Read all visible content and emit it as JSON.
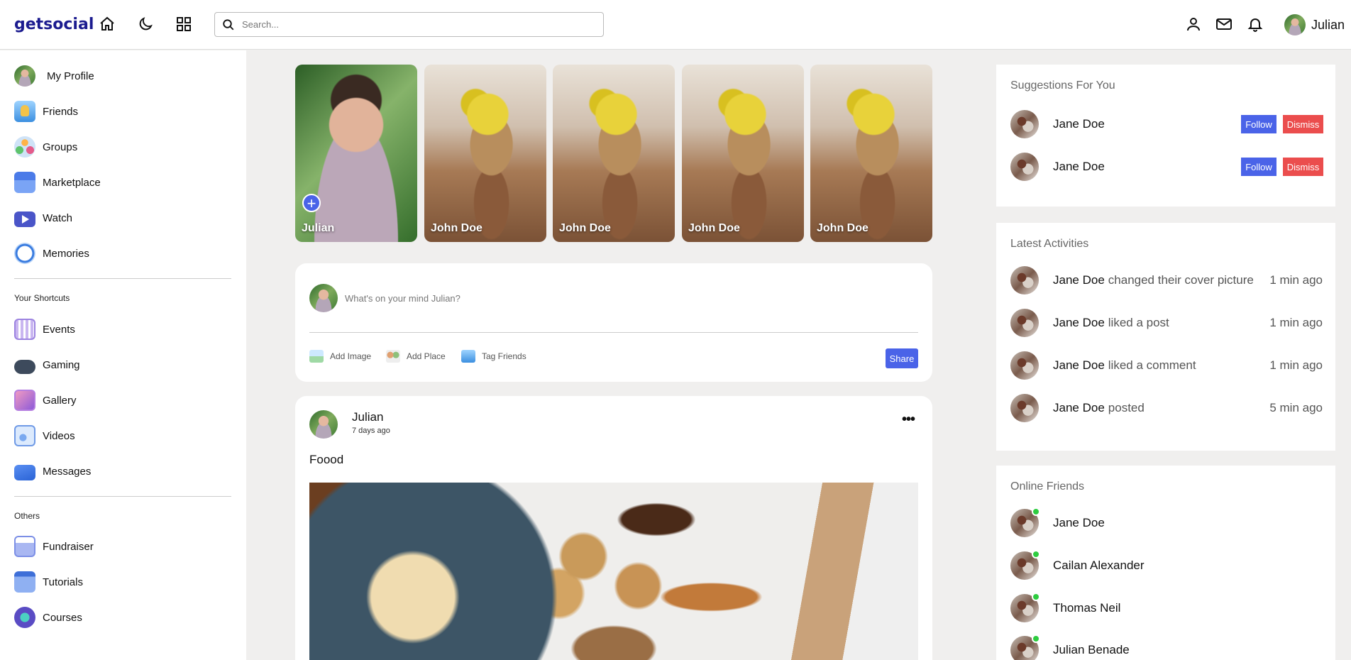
{
  "navbar": {
    "logo": "getsocial",
    "search_placeholder": "Search...",
    "user_name": "Julian"
  },
  "sidebar": {
    "main_items": [
      {
        "label": "My Profile",
        "icon": "profile-avatar"
      },
      {
        "label": "Friends",
        "icon": "friends-icon"
      },
      {
        "label": "Groups",
        "icon": "groups-icon"
      },
      {
        "label": "Marketplace",
        "icon": "marketplace-icon"
      },
      {
        "label": "Watch",
        "icon": "watch-icon"
      },
      {
        "label": "Memories",
        "icon": "memories-icon"
      }
    ],
    "shortcuts_title": "Your Shortcuts",
    "shortcuts": [
      {
        "label": "Events",
        "icon": "events-icon"
      },
      {
        "label": "Gaming",
        "icon": "gaming-icon"
      },
      {
        "label": "Gallery",
        "icon": "gallery-icon"
      },
      {
        "label": "Videos",
        "icon": "videos-icon"
      },
      {
        "label": "Messages",
        "icon": "messages-icon"
      }
    ],
    "others_title": "Others",
    "others": [
      {
        "label": "Fundraiser",
        "icon": "fundraiser-icon"
      },
      {
        "label": "Tutorials",
        "icon": "tutorials-icon"
      },
      {
        "label": "Courses",
        "icon": "courses-icon"
      }
    ]
  },
  "stories": [
    {
      "name": "Julian"
    },
    {
      "name": "John Doe"
    },
    {
      "name": "John Doe"
    },
    {
      "name": "John Doe"
    },
    {
      "name": "John Doe"
    }
  ],
  "composer": {
    "placeholder": "What's on your mind Julian?",
    "add_image": "Add Image",
    "add_place": "Add Place",
    "tag_friends": "Tag Friends",
    "share": "Share"
  },
  "post": {
    "author": "Julian",
    "time": "7 days ago",
    "text": "Foood"
  },
  "suggestions": {
    "title": "Suggestions For You",
    "items": [
      {
        "name": "Jane Doe"
      },
      {
        "name": "Jane Doe"
      }
    ],
    "follow_label": "Follow",
    "dismiss_label": "Dismiss"
  },
  "activities": {
    "title": "Latest Activities",
    "items": [
      {
        "name": "Jane Doe",
        "action": "changed their cover picture",
        "time": "1 min ago"
      },
      {
        "name": "Jane Doe",
        "action": "liked a post",
        "time": "1 min ago"
      },
      {
        "name": "Jane Doe",
        "action": "liked a comment",
        "time": "1 min ago"
      },
      {
        "name": "Jane Doe",
        "action": "posted",
        "time": "5 min ago"
      }
    ]
  },
  "online": {
    "title": "Online Friends",
    "items": [
      {
        "name": "Jane Doe"
      },
      {
        "name": "Cailan Alexander"
      },
      {
        "name": "Thomas Neil"
      },
      {
        "name": "Julian Benade"
      }
    ]
  },
  "colors": {
    "accent": "#4a63e8",
    "danger": "#eb4d4d",
    "online": "#2ecc40",
    "logo": "#1b1b8f"
  }
}
